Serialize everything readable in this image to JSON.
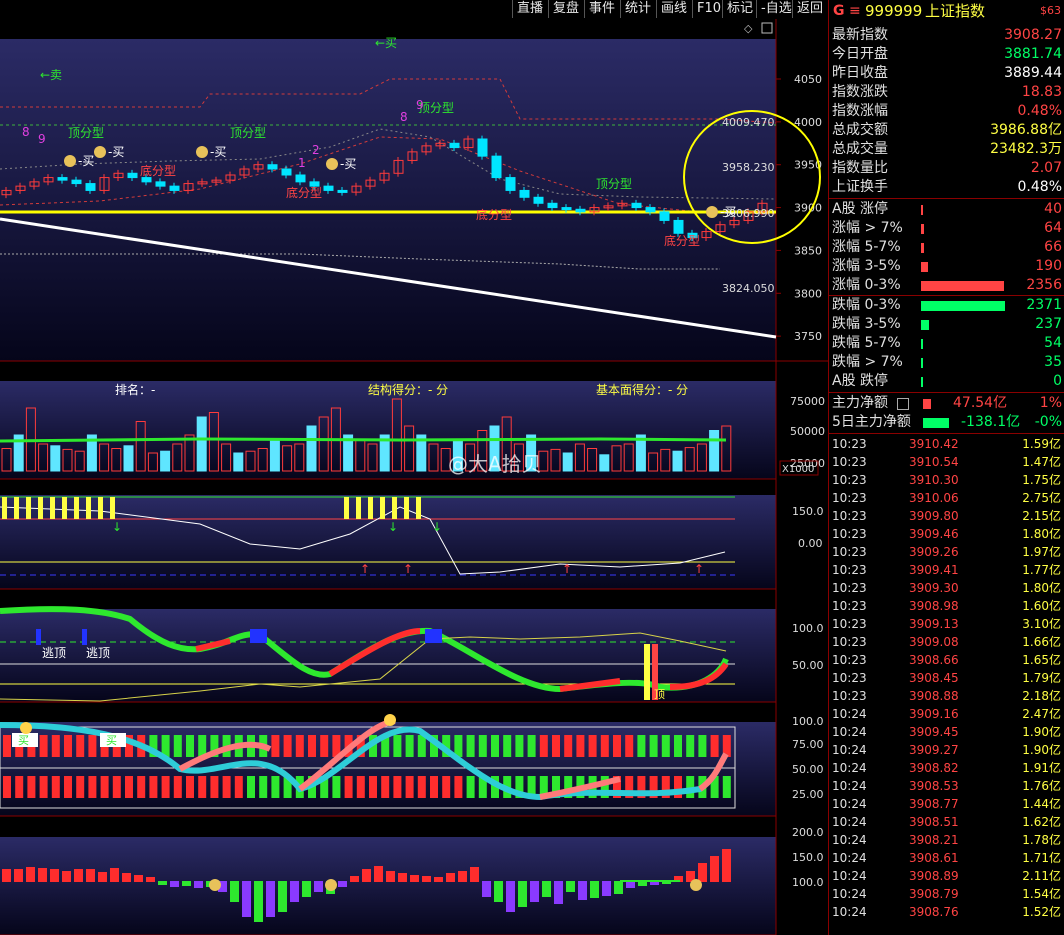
{
  "toolbar": {
    "items": [
      "直播",
      "复盘",
      "事件",
      "统计",
      "画线",
      "F10",
      "标记",
      "-自选",
      "返回"
    ]
  },
  "main_chart": {
    "y_axis_ticks": [
      "4050",
      "4000",
      "3950",
      "3900",
      "3850",
      "3800",
      "3750"
    ],
    "price_labels": [
      "4009.470",
      "3958.230",
      "3906.990",
      "3824.050"
    ],
    "signals": {
      "buy": "买",
      "sell": "卖",
      "buy_arrow": "←买",
      "sell_arrow": "←卖",
      "top": "顶分型",
      "bottom": "底分型",
      "seq_8": "8",
      "seq_9": "9",
      "seq_1": "1",
      "seq_2": "2"
    },
    "colors": {
      "up": "#ff3b3b",
      "down": "#00e5ff",
      "ma_line": "#ffff00",
      "trend": "#ffffff"
    }
  },
  "volume_panel": {
    "rank": "排名：-",
    "structure": "结构得分：- 分",
    "fundamental": "基本面得分：- 分",
    "y_ticks": [
      "75000",
      "50000",
      "25000"
    ],
    "unit": "X1000"
  },
  "osc1": {
    "y_ticks": [
      "150.0",
      "0.00"
    ]
  },
  "osc2": {
    "y_ticks": [
      "100.0",
      "50.00"
    ],
    "labels": [
      "逃顶",
      "逃顶"
    ],
    "warn": "顶"
  },
  "osc3": {
    "y_ticks": [
      "100.0",
      "75.00",
      "50.00",
      "25.00"
    ],
    "sell_label": "卖",
    "buy_label": "买"
  },
  "osc4": {
    "y_ticks": [
      "200.0",
      "150.0",
      "100.0"
    ]
  },
  "watermark": "@大A拾贝",
  "right_panel": {
    "code": "999999",
    "name": "上证指数",
    "tag": "$63",
    "stats": [
      {
        "label": "最新指数",
        "value": "3908.27",
        "color": "#ff4444"
      },
      {
        "label": "今日开盘",
        "value": "3881.74",
        "color": "#00ff66"
      },
      {
        "label": "昨日收盘",
        "value": "3889.44",
        "color": "#ffffff"
      },
      {
        "label": "指数涨跌",
        "value": "18.83",
        "color": "#ff4444"
      },
      {
        "label": "指数涨幅",
        "value": "0.48%",
        "color": "#ff4444"
      },
      {
        "label": "总成交额",
        "value": "3986.88亿",
        "color": "#ffff44"
      },
      {
        "label": "总成交量",
        "value": "23482.3万",
        "color": "#ffff44"
      },
      {
        "label": "指数量比",
        "value": "2.07",
        "color": "#ff4444"
      },
      {
        "label": "上证换手",
        "value": "0.48%",
        "color": "#ffffff"
      }
    ],
    "breadth": [
      {
        "label": "A股 涨停",
        "value": "40",
        "color": "#ff4444",
        "fill": 0.01
      },
      {
        "label": "涨幅 > 7%",
        "value": "64",
        "color": "#ff4444",
        "fill": 0.03
      },
      {
        "label": "涨幅 5-7%",
        "value": "66",
        "color": "#ff4444",
        "fill": 0.03
      },
      {
        "label": "涨幅 3-5%",
        "value": "190",
        "color": "#ff4444",
        "fill": 0.08
      },
      {
        "label": "涨幅 0-3%",
        "value": "2356",
        "color": "#ff4444",
        "fill": 0.99
      },
      {
        "label": "跌幅 0-3%",
        "value": "2371",
        "color": "#00ff66",
        "fill": 1.0
      },
      {
        "label": "跌幅 3-5%",
        "value": "237",
        "color": "#00ff66",
        "fill": 0.1
      },
      {
        "label": "跌幅 5-7%",
        "value": "54",
        "color": "#00ff66",
        "fill": 0.02
      },
      {
        "label": "跌幅 > 7%",
        "value": "35",
        "color": "#00ff66",
        "fill": 0.01
      },
      {
        "label": "A股 跌停",
        "value": "0",
        "color": "#00ff66",
        "fill": 0.005
      }
    ],
    "main_flow": {
      "label": "主力净额",
      "value": "47.54亿",
      "pct": "1%"
    },
    "flow5": {
      "label": "5日主力净额",
      "value": "-138.1亿",
      "pct": "-0%"
    },
    "ticks": [
      [
        "10:23",
        "3910.42",
        "1.59亿"
      ],
      [
        "10:23",
        "3910.54",
        "1.47亿"
      ],
      [
        "10:23",
        "3910.30",
        "1.75亿"
      ],
      [
        "10:23",
        "3910.06",
        "2.75亿"
      ],
      [
        "10:23",
        "3909.80",
        "2.15亿"
      ],
      [
        "10:23",
        "3909.46",
        "1.80亿"
      ],
      [
        "10:23",
        "3909.26",
        "1.97亿"
      ],
      [
        "10:23",
        "3909.41",
        "1.77亿"
      ],
      [
        "10:23",
        "3909.30",
        "1.80亿"
      ],
      [
        "10:23",
        "3908.98",
        "1.60亿"
      ],
      [
        "10:23",
        "3909.13",
        "3.10亿"
      ],
      [
        "10:23",
        "3909.08",
        "1.66亿"
      ],
      [
        "10:23",
        "3908.66",
        "1.65亿"
      ],
      [
        "10:23",
        "3908.45",
        "1.79亿"
      ],
      [
        "10:23",
        "3908.88",
        "2.18亿"
      ],
      [
        "10:24",
        "3909.16",
        "2.47亿"
      ],
      [
        "10:24",
        "3909.45",
        "1.90亿"
      ],
      [
        "10:24",
        "3909.27",
        "1.90亿"
      ],
      [
        "10:24",
        "3908.82",
        "1.91亿"
      ],
      [
        "10:24",
        "3908.53",
        "1.76亿"
      ],
      [
        "10:24",
        "3908.77",
        "1.44亿"
      ],
      [
        "10:24",
        "3908.51",
        "1.62亿"
      ],
      [
        "10:24",
        "3908.21",
        "1.78亿"
      ],
      [
        "10:24",
        "3908.61",
        "1.71亿"
      ],
      [
        "10:24",
        "3908.89",
        "2.11亿"
      ],
      [
        "10:24",
        "3908.79",
        "1.54亿"
      ],
      [
        "10:24",
        "3908.76",
        "1.52亿"
      ]
    ]
  }
}
